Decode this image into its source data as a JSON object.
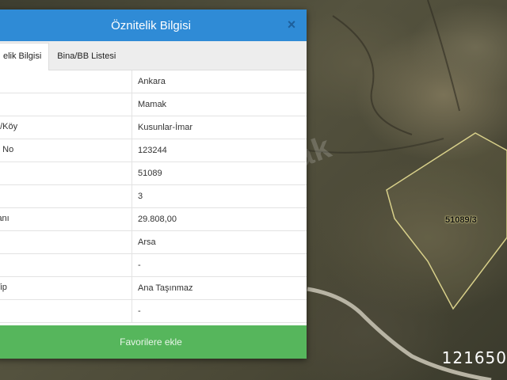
{
  "map": {
    "parcel_label": "51089/3",
    "watermark": "ak",
    "corner_number": "121650"
  },
  "dialog": {
    "title": "Öznitelik Bilgisi",
    "close_icon": "×",
    "tabs": [
      {
        "label": "elik Bilgisi"
      },
      {
        "label": "Bina/BB Listesi"
      }
    ],
    "rows": [
      {
        "key": "",
        "value": "Ankara"
      },
      {
        "key": "",
        "value": "Mamak"
      },
      {
        "key": "e/Köy",
        "value": "Kusunlar-İmar"
      },
      {
        "key": "e No",
        "value": "123244"
      },
      {
        "key": "",
        "value": "51089"
      },
      {
        "key": "",
        "value": "3"
      },
      {
        "key": "lanı",
        "value": "29.808,00"
      },
      {
        "key": "",
        "value": "Arsa"
      },
      {
        "key": "",
        "value": "-"
      },
      {
        "key": " Tip",
        "value": "Ana Taşınmaz"
      },
      {
        "key": "",
        "value": "-"
      }
    ],
    "favorite_button": "Favorilere ekle"
  }
}
